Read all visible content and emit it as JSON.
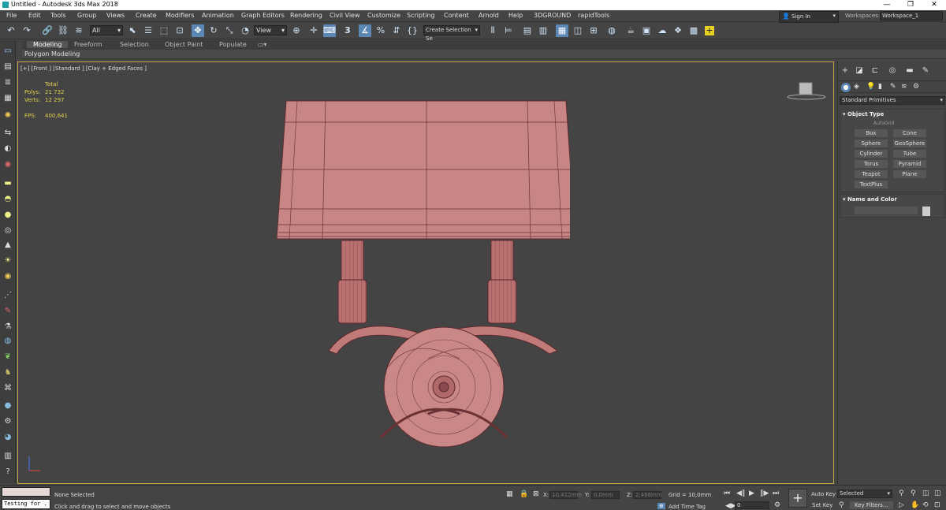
{
  "window": {
    "title": "Untitled - Autodesk 3ds Max 2018",
    "minimize": "—",
    "restore": "❐",
    "close": "✕"
  },
  "menu": {
    "items": [
      "File",
      "Edit",
      "Tools",
      "Group",
      "Views",
      "Create",
      "Modifiers",
      "Animation",
      "Graph Editors",
      "Rendering",
      "Civil View",
      "Customize",
      "Scripting",
      "Content",
      "Arnold",
      "Help",
      "3DGROUND",
      "rapidTools"
    ],
    "sign_in": "Sign In",
    "workspaces_label": "Workspaces:",
    "workspace_value": "Workspace_1"
  },
  "toolbar": {
    "filter_value": "All",
    "view_value": "View",
    "selection_set": "Create Selection Se",
    "snap_value": "3"
  },
  "ribbon": {
    "tabs": [
      "Modeling",
      "Freeform",
      "Selection",
      "Object Paint",
      "Populate"
    ],
    "active_tab": "Modeling",
    "sub_label": "Polygon Modeling"
  },
  "viewport": {
    "label": "[+] [Front ] [Standard ] [Clay + Edged Faces ]",
    "stats": {
      "total_label": "Total",
      "polys_label": "Polys:",
      "polys_value": "21 732",
      "verts_label": "Verts:",
      "verts_value": "12 297",
      "fps_label": "FPS:",
      "fps_value": "400,641"
    },
    "model_color": "#c08080",
    "border_color": "#c8a64b"
  },
  "command_panel": {
    "category": "Standard Primitives",
    "object_type_title": "Object Type",
    "autogrid": "AutoGrid",
    "buttons": [
      "Box",
      "Cone",
      "Sphere",
      "GeoSphere",
      "Cylinder",
      "Tube",
      "Torus",
      "Pyramid",
      "Teapot",
      "Plane",
      "TextPlus"
    ],
    "name_color_title": "Name and Color"
  },
  "status": {
    "script_value": "Testing for .",
    "selection_status": "None Selected",
    "prompt": "Click and drag to select and move objects",
    "x_label": "X:",
    "x_value": "10,412mm",
    "y_label": "Y:",
    "y_value": "0,0mm",
    "z_label": "Z:",
    "z_value": "2,466mm",
    "grid": "Grid = 10,0mm",
    "add_time_tag": "Add Time Tag",
    "frame_value": "0",
    "auto_key": "Auto Key",
    "set_key": "Set Key",
    "selected_value": "Selected",
    "key_filters": "Key Filters..."
  }
}
